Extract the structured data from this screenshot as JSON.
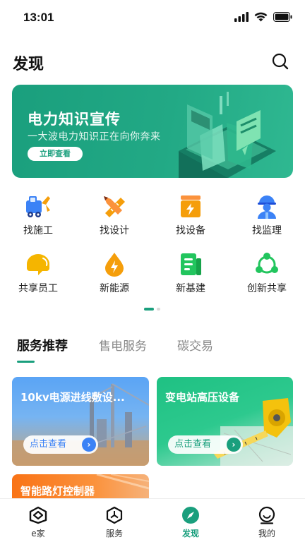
{
  "status_bar": {
    "time": "13:01"
  },
  "header": {
    "title": "发现"
  },
  "banner": {
    "title": "电力知识宣传",
    "subtitle": "一大波电力知识正在向你奔来",
    "button": "立即查看"
  },
  "grid": [
    {
      "label": "找施工",
      "icon": "construction-vehicle-icon"
    },
    {
      "label": "找设计",
      "icon": "ruler-pencil-icon"
    },
    {
      "label": "找设备",
      "icon": "equipment-box-icon"
    },
    {
      "label": "找监理",
      "icon": "supervisor-worker-icon"
    },
    {
      "label": "共享员工",
      "icon": "shared-worker-icon"
    },
    {
      "label": "新能源",
      "icon": "energy-drop-icon"
    },
    {
      "label": "新基建",
      "icon": "infrastructure-doc-icon"
    },
    {
      "label": "创新共享",
      "icon": "share-network-icon"
    }
  ],
  "tabs": [
    {
      "label": "服务推荐"
    },
    {
      "label": "售电服务"
    },
    {
      "label": "碳交易"
    }
  ],
  "cards": [
    {
      "title": "10kv电源进线敷设...",
      "button": "点击查看"
    },
    {
      "title": "变电站高压设备",
      "button": "点击查看"
    },
    {
      "title": "智能路灯控制器"
    }
  ],
  "bottom_nav": [
    {
      "label": "e家"
    },
    {
      "label": "服务"
    },
    {
      "label": "发现"
    },
    {
      "label": "我的"
    }
  ],
  "colors": {
    "accent": "#1a9f7d",
    "blue": "#3b82f6",
    "orange": "#f59e0b",
    "green": "#22c55e"
  }
}
